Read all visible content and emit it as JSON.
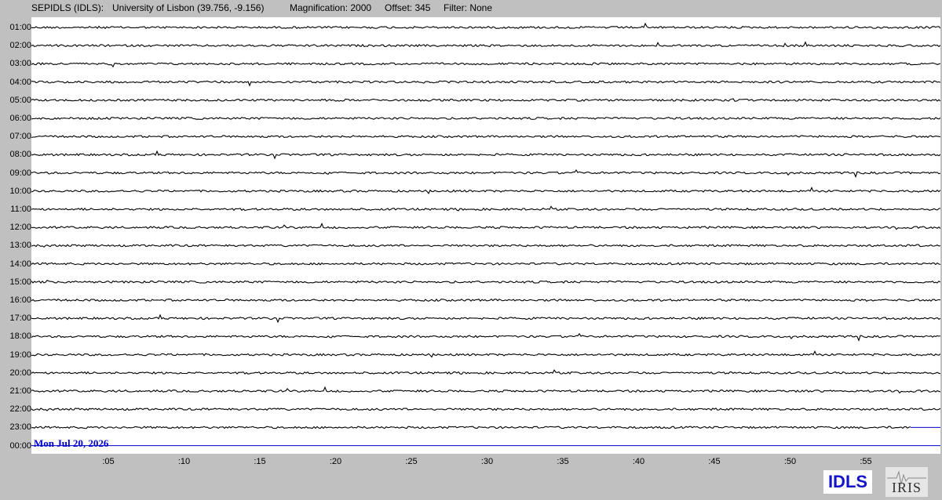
{
  "header": {
    "station": "SEPIDLS (IDLS):",
    "location": "University of Lisbon (39.756, -9.156)",
    "magnification": "Magnification: 2000",
    "offset": "Offset: 345",
    "filter": "Filter: None"
  },
  "hours": [
    "01:00",
    "02:00",
    "03:00",
    "04:00",
    "05:00",
    "06:00",
    "07:00",
    "08:00",
    "09:00",
    "10:00",
    "11:00",
    "12:00",
    "13:00",
    "14:00",
    "15:00",
    "16:00",
    "17:00",
    "18:00",
    "19:00",
    "20:00",
    "21:00",
    "22:00",
    "23:00",
    "00:00"
  ],
  "minutes": [
    ":05",
    ":10",
    ":15",
    ":20",
    ":25",
    ":30",
    ":35",
    ":40",
    ":45",
    ":50",
    ":55"
  ],
  "date": "Mon Jul 20, 2026",
  "logos": {
    "idls": "IDLS",
    "iris": "IRIS"
  },
  "colors": {
    "background": "#c0c0c0",
    "plot": "#ffffff",
    "trace": "#000000",
    "date_line": "#0000cc",
    "idls_logo": "#1515c8"
  }
}
